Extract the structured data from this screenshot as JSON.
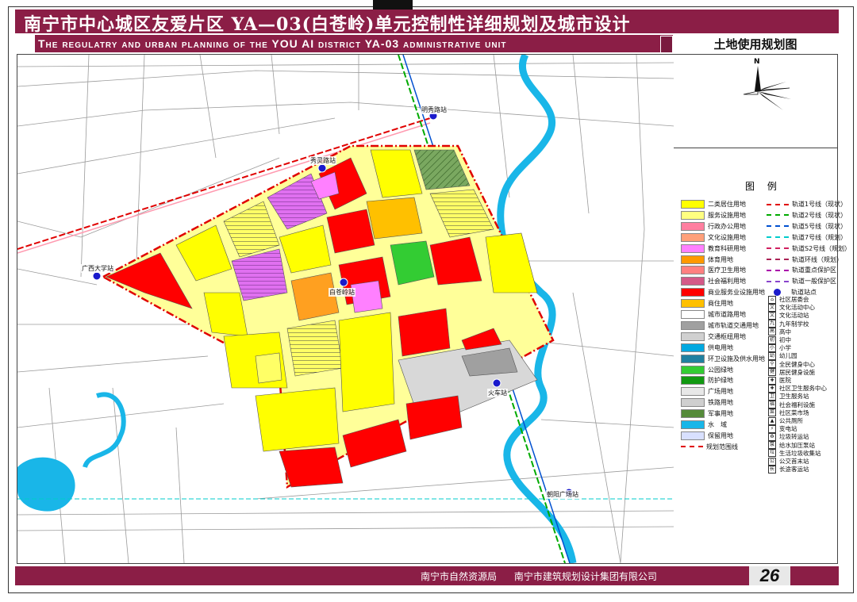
{
  "header": {
    "title": "南宁市中心城区友爱片区 YA—03(白苍岭)单元控制性详细规划及城市设计",
    "subtitle": "The regulatry and urban planning of the YOU AI district YA-03 administrative unit",
    "map_title": "土地使用规划图"
  },
  "compass": {
    "north_label": "N"
  },
  "map": {
    "stations": [
      {
        "name": "明秀路站"
      },
      {
        "name": "秀灵路站"
      },
      {
        "name": "广西大学站"
      },
      {
        "name": "白苍岭站"
      },
      {
        "name": "火车站"
      },
      {
        "name": "朝阳广场站"
      }
    ]
  },
  "legend": {
    "title": "图 例",
    "land_use": [
      {
        "label": "二类居住用地",
        "color": "#ffff00"
      },
      {
        "label": "服务设施用地",
        "color": "#ffff80"
      },
      {
        "label": "行政办公用地",
        "color": "#ff7fa0"
      },
      {
        "label": "文化设施用地",
        "color": "#ffa07a"
      },
      {
        "label": "教育科研用地",
        "color": "#ff80ff"
      },
      {
        "label": "体育用地",
        "color": "#ff9900"
      },
      {
        "label": "医疗卫生用地",
        "color": "#ff8080"
      },
      {
        "label": "社会福利用地",
        "color": "#d45a88"
      },
      {
        "label": "商业服务业设施用地",
        "color": "#ff0000"
      },
      {
        "label": "商住用地",
        "color": "#ffc000"
      },
      {
        "label": "城市道路用地",
        "color": "#ffffff"
      },
      {
        "label": "城市轨道交通用地",
        "color": "#a0a0a0"
      },
      {
        "label": "交通枢纽用地",
        "color": "#d0d0d0"
      },
      {
        "label": "供电用地",
        "color": "#00a8e0"
      },
      {
        "label": "环卫设施及供水用地",
        "color": "#2080a0"
      },
      {
        "label": "公园绿地",
        "color": "#33cc33"
      },
      {
        "label": "防护绿地",
        "color": "#119911"
      },
      {
        "label": "广场用地",
        "color": "#e8e8e8"
      },
      {
        "label": "铁路用地",
        "color": "#cfcfcf"
      },
      {
        "label": "军事用地",
        "color": "#558b3a"
      },
      {
        "label": "水　域",
        "color": "#19b6e8"
      },
      {
        "label": "保留用地",
        "color": "#d8e0ff"
      },
      {
        "label": "规划范围线",
        "color": "#e00000"
      }
    ],
    "lines": [
      {
        "label": "轨道1号线（现状）",
        "color": "#e00000"
      },
      {
        "label": "轨道2号线（现状）",
        "color": "#00aa00"
      },
      {
        "label": "轨道5号线（现状）",
        "color": "#0050d0"
      },
      {
        "label": "轨道7号线（规划）",
        "color": "#00cccc"
      },
      {
        "label": "轨道S2号线（规划）",
        "color": "#d02060"
      },
      {
        "label": "轨道环线（规划）",
        "color": "#aa2255"
      },
      {
        "label": "轨道重点保护区",
        "color": "#aa00aa"
      },
      {
        "label": "轨道一般保护区",
        "color": "#8844cc"
      },
      {
        "label": "轨道站点",
        "color": "#1a1acc"
      }
    ],
    "facilities": [
      {
        "label": "社区居委会",
        "icon": "house-icon",
        "glyph": "⌂"
      },
      {
        "label": "文化活动中心",
        "icon": "culture-center-icon",
        "glyph": "文"
      },
      {
        "label": "文化活动站",
        "icon": "culture-station-icon",
        "glyph": "文"
      },
      {
        "label": "九年制学校",
        "icon": "nine-year-school-icon",
        "glyph": "九"
      },
      {
        "label": "高中",
        "icon": "high-school-icon",
        "glyph": "高"
      },
      {
        "label": "初中",
        "icon": "middle-school-icon",
        "glyph": "初"
      },
      {
        "label": "小学",
        "icon": "primary-school-icon",
        "glyph": "小"
      },
      {
        "label": "幼儿园",
        "icon": "kindergarten-icon",
        "glyph": "幼"
      },
      {
        "label": "全民健身中心",
        "icon": "fitness-center-icon",
        "glyph": "⚲"
      },
      {
        "label": "居民健身设施",
        "icon": "fitness-facility-icon",
        "glyph": "健"
      },
      {
        "label": "医院",
        "icon": "hospital-icon",
        "glyph": "✚"
      },
      {
        "label": "社区卫生服务中心",
        "icon": "health-center-icon",
        "glyph": "✚"
      },
      {
        "label": "卫生服务站",
        "icon": "health-station-icon",
        "glyph": "卫"
      },
      {
        "label": "社会福利设施",
        "icon": "welfare-icon",
        "glyph": "福"
      },
      {
        "label": "社区菜市场",
        "icon": "market-icon",
        "glyph": "菜"
      },
      {
        "label": "公共厕所",
        "icon": "toilet-icon",
        "glyph": "▲"
      },
      {
        "label": "变电站",
        "icon": "substation-icon",
        "glyph": "⚡"
      },
      {
        "label": "垃圾转运站",
        "icon": "waste-transfer-icon",
        "glyph": "♻"
      },
      {
        "label": "给水加压泵站",
        "icon": "pump-station-icon",
        "glyph": "泵"
      },
      {
        "label": "生活垃圾收集站",
        "icon": "waste-collection-icon",
        "glyph": "垃"
      },
      {
        "label": "公交首末站",
        "icon": "bus-terminal-icon",
        "glyph": "公"
      },
      {
        "label": "长途客运站",
        "icon": "coach-station-icon",
        "glyph": "长"
      }
    ]
  },
  "footer": {
    "agencies": "南宁市自然资源局 南宁市建筑规划设计集团有限公司",
    "page_number": "26"
  }
}
